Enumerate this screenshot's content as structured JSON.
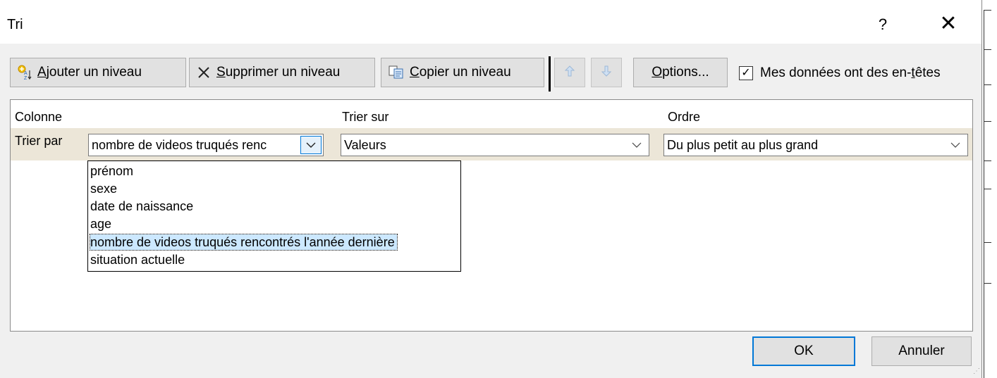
{
  "dialog": {
    "title": "Tri",
    "help_label": "?",
    "close_label": "✕"
  },
  "toolbar": {
    "add_level": {
      "prefix": "",
      "accel": "A",
      "rest": "jouter un niveau"
    },
    "delete_level": {
      "accel": "S",
      "rest": "upprimer un niveau"
    },
    "copy_level": {
      "accel": "C",
      "rest": "opier un niveau"
    },
    "options": {
      "accel": "O",
      "rest": "ptions..."
    },
    "headers_checkbox": {
      "before": "Mes données ont des en-",
      "accel": "t",
      "after": "êtes",
      "checked": true
    }
  },
  "grid": {
    "headers": {
      "column": "Colonne",
      "sort_on": "Trier sur",
      "order": "Ordre"
    },
    "row": {
      "label": "Trier par",
      "column_value": "nombre de videos truqués renc",
      "sort_on_value": "Valeurs",
      "order_value": "Du plus petit au plus grand"
    }
  },
  "column_options": [
    "prénom",
    "sexe",
    "date de naissance",
    "age",
    "nombre de videos truqués rencontrés l'année dernière",
    "situation actuelle"
  ],
  "selected_index": 4,
  "buttons": {
    "ok": "OK",
    "cancel": "Annuler"
  },
  "colors": {
    "accent": "#0078d7",
    "selection": "#cce8ff",
    "row_band": "#ece6d8"
  }
}
